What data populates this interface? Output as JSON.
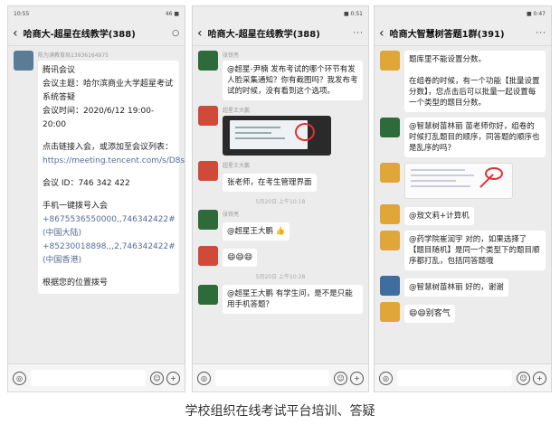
{
  "caption": "学校组织在线考试平台培训、答疑",
  "phones": [
    {
      "status_time": "10:55",
      "status_right": "46 ■",
      "title": "哈商大-超星在线教学(388)",
      "messages": [
        {
          "sender": "陈为满教育局13936164975"
        },
        {
          "text_lines": [
            "腾讯会议",
            "会议主题：哈尔滨商业大学超星考试系统答疑",
            "会议时间：2020/6/12 19:00-20:00",
            "",
            "点击链接入会，或添加至会议列表：",
            "https://meeting.tencent.com/s/D8ssVc5TTYMd",
            "",
            "会议 ID：746 342 422",
            "",
            "手机一键拨号入会",
            "+8675536550000,,746342422#(中国大陆)",
            "+85230018898,,,2,746342422#(中国香港)",
            "",
            "根据您的位置拨号"
          ]
        }
      ]
    },
    {
      "status_time": "",
      "status_right": "■ 0:51",
      "title": "哈商大-超星在线教学(388)",
      "messages": [
        {
          "sender": "张铁亮",
          "text": "@超星-尹楠 发布考试的哪个环节有发人脸采集通知？你有截图吗？我发布考试的时候，没有看到这个选项。"
        },
        {
          "sender": "超星王大鹏",
          "image": "screenshot"
        },
        {
          "sender": "超星王大鹏",
          "text": "张老师，在考生管理界面"
        },
        {
          "time": "5月20日 上午10:18"
        },
        {
          "sender": "张铁亮",
          "text": "@超星王大鹏 👍"
        },
        {
          "sender": "",
          "text": "😄😄😄"
        },
        {
          "time": "5月20日 上午10:28"
        },
        {
          "sender": "",
          "text": "@超星王大鹏 有学生问，是不是只能用手机答题？"
        }
      ]
    },
    {
      "status_time": "",
      "status_right": "■ 0:47",
      "title": "哈商大智慧树答题1群(391)",
      "messages": [
        {
          "sender": "",
          "text": "题库里不能设置分数。\n\n在组卷的时候，有一个功能【批量设置分数】，您点击后可以批量一起设置每一个类型的题目分数。"
        },
        {
          "sender": "",
          "text": "@智慧树苗林丽 苗老师你好，组卷的时候打乱题目的顺序，同答题的顺序也是乱序的吗？"
        },
        {
          "sender": "",
          "image": "screenshot2"
        },
        {
          "sender": "",
          "text": "@敖文莉+计算机"
        },
        {
          "sender": "",
          "text": "@药学院崔润宇 对的，如果选择了【题目随机】是同一个类型下的题目顺序都打乱，包括同答题哦"
        },
        {
          "sender": "",
          "text": "@智慧树苗林丽 好的，谢谢"
        },
        {
          "sender": "",
          "text": "😄😄别客气"
        }
      ]
    }
  ]
}
